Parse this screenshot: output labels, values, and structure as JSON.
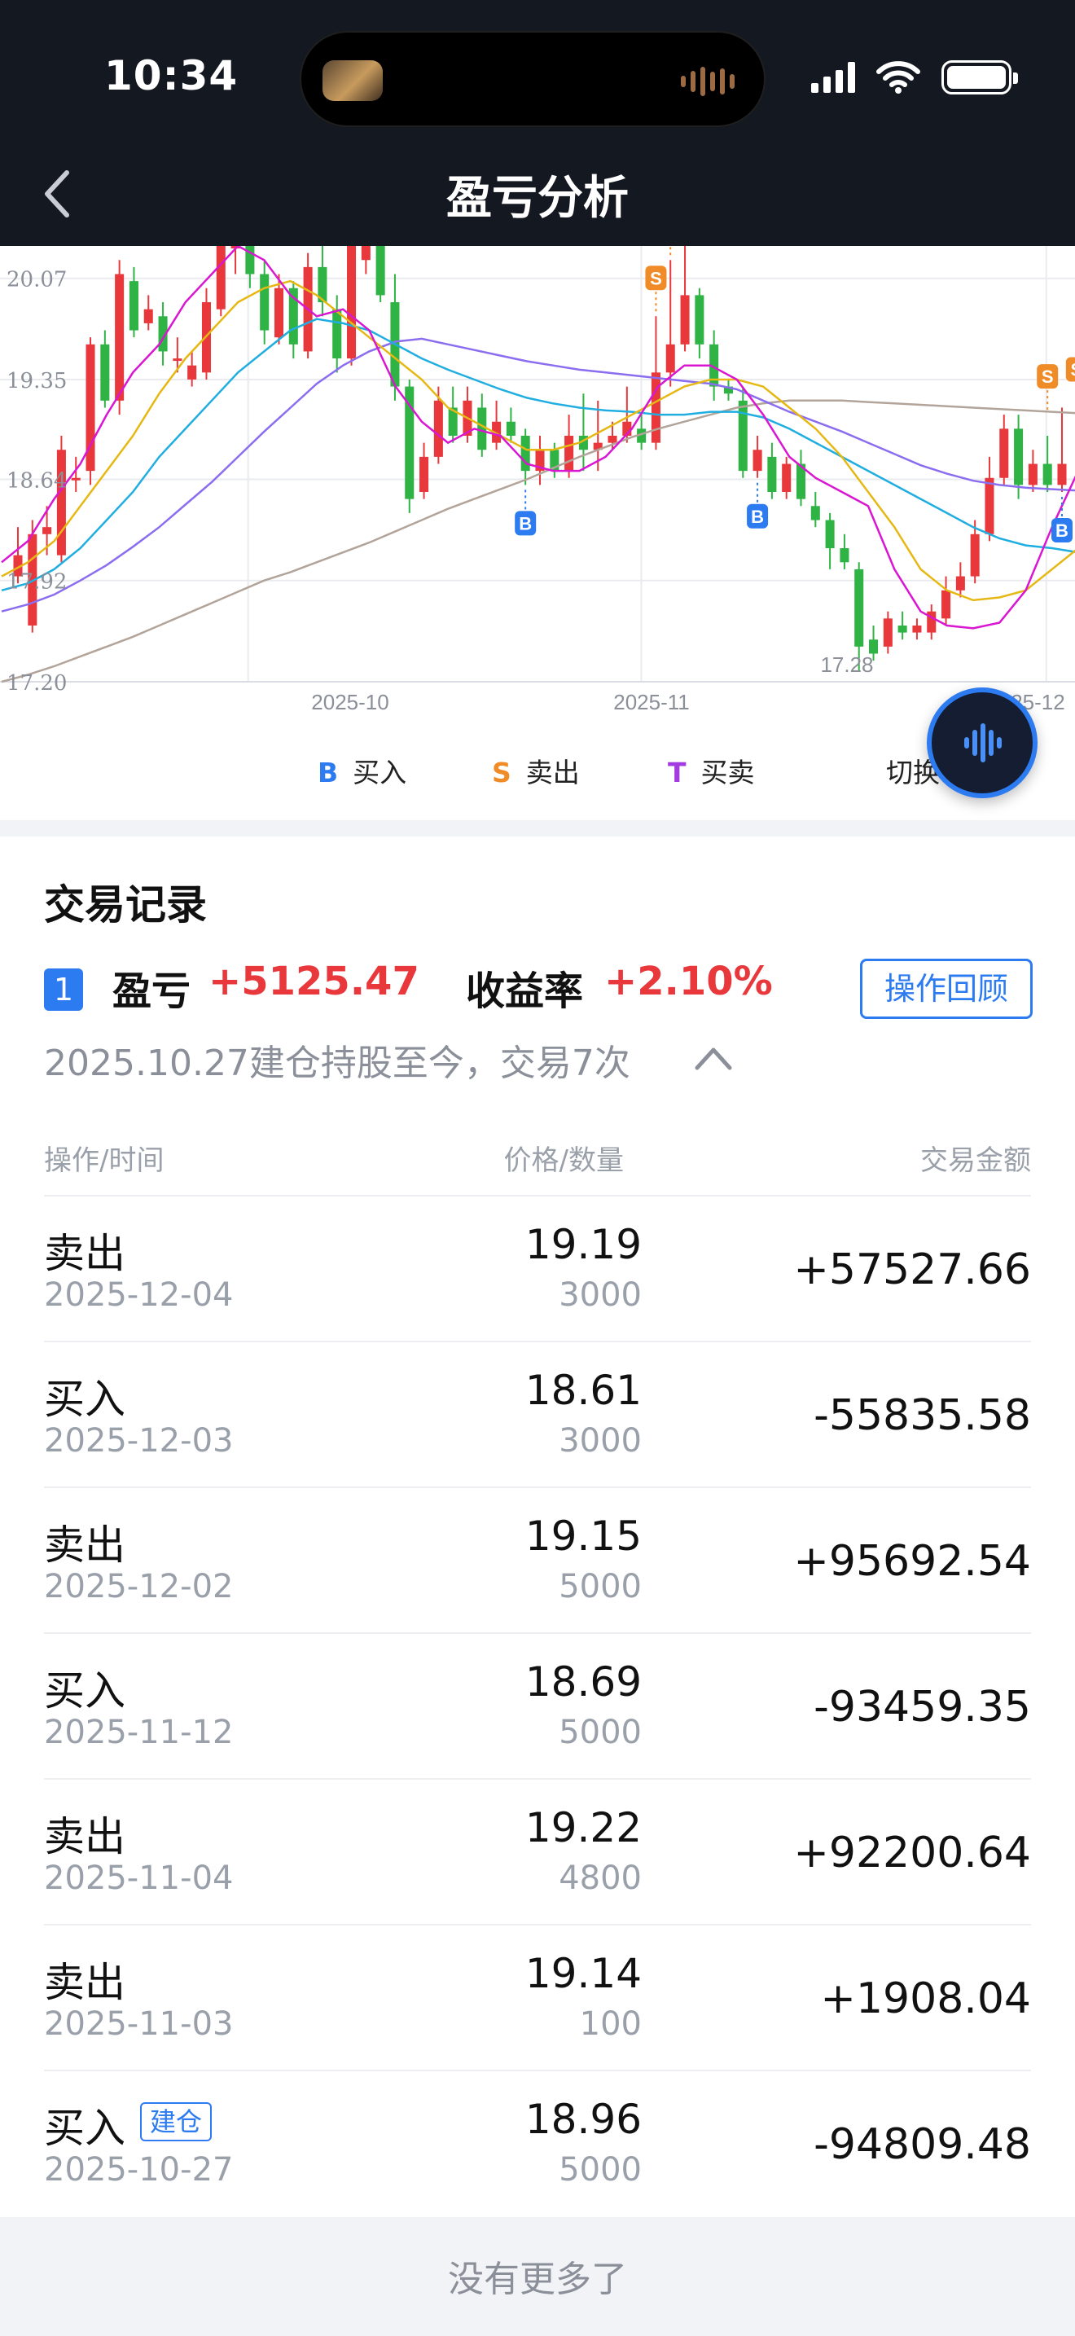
{
  "status_bar": {
    "time": "10:34"
  },
  "nav": {
    "title": "盈亏分析"
  },
  "chart": {
    "y_labels": [
      "20.07",
      "19.35",
      "18.64",
      "17.92",
      "17.20"
    ],
    "x_labels": [
      "2025-10",
      "2025-11",
      "2025-12"
    ],
    "min_label": "17.28",
    "legend": [
      {
        "key": "B",
        "label": "买入",
        "color": "#2d7bf0"
      },
      {
        "key": "S",
        "label": "卖出",
        "color": "#f08c28"
      },
      {
        "key": "T",
        "label": "买卖",
        "color": "#a23be0"
      }
    ],
    "switch_label": "切换",
    "colors": {
      "up": "#e8383c",
      "down": "#2fb344",
      "ma5": "#d916d1",
      "ma10": "#e6b814",
      "ma20": "#20aee0",
      "ma30": "#8b6df0",
      "ma60": "#b3a49a"
    }
  },
  "chart_data": {
    "type": "candlestick",
    "ylim": [
      17.2,
      20.3
    ],
    "x_ticks": [
      "2025-10",
      "2025-11",
      "2025-12"
    ],
    "y_ticks": [
      20.07,
      19.35,
      18.64,
      17.92,
      17.2
    ],
    "candles": [
      [
        17.95,
        18.1,
        17.9,
        18.3
      ],
      [
        17.6,
        18.25,
        17.55,
        18.35
      ],
      [
        18.25,
        18.3,
        18.1,
        18.45
      ],
      [
        18.1,
        18.85,
        18.05,
        18.95
      ],
      [
        18.65,
        18.65,
        18.55,
        18.8
      ],
      [
        18.7,
        19.6,
        18.6,
        19.65
      ],
      [
        19.6,
        19.2,
        19.15,
        19.7
      ],
      [
        19.2,
        20.1,
        19.1,
        20.2
      ],
      [
        20.05,
        19.7,
        19.65,
        20.15
      ],
      [
        19.75,
        19.85,
        19.7,
        19.95
      ],
      [
        19.8,
        19.55,
        19.45,
        19.9
      ],
      [
        19.5,
        19.5,
        19.4,
        19.65
      ],
      [
        19.35,
        19.45,
        19.3,
        19.55
      ],
      [
        19.4,
        19.9,
        19.35,
        20.0
      ],
      [
        19.85,
        20.3,
        19.8,
        20.5
      ],
      [
        20.3,
        20.3,
        20.1,
        20.5
      ],
      [
        20.3,
        20.1,
        20.0,
        20.4
      ],
      [
        20.1,
        19.7,
        19.6,
        20.2
      ],
      [
        19.65,
        20.0,
        19.6,
        20.1
      ],
      [
        20.0,
        19.6,
        19.5,
        20.05
      ],
      [
        19.55,
        20.15,
        19.5,
        20.25
      ],
      [
        20.15,
        19.9,
        19.8,
        20.3
      ],
      [
        19.85,
        19.5,
        19.4,
        19.95
      ],
      [
        19.5,
        20.3,
        19.45,
        20.45
      ],
      [
        20.2,
        20.4,
        20.1,
        20.5
      ],
      [
        20.4,
        19.95,
        19.9,
        20.45
      ],
      [
        19.9,
        19.3,
        19.2,
        20.1
      ],
      [
        19.3,
        18.5,
        18.4,
        19.35
      ],
      [
        18.55,
        18.8,
        18.5,
        18.9
      ],
      [
        18.8,
        19.2,
        18.75,
        19.3
      ],
      [
        19.15,
        18.95,
        18.9,
        19.3
      ],
      [
        18.95,
        19.2,
        18.9,
        19.3
      ],
      [
        19.15,
        18.85,
        18.8,
        19.25
      ],
      [
        18.9,
        19.05,
        18.85,
        19.2
      ],
      [
        19.05,
        18.95,
        18.9,
        19.15
      ],
      [
        18.95,
        18.7,
        18.6,
        19.0
      ],
      [
        18.7,
        18.85,
        18.6,
        18.95
      ],
      [
        18.85,
        18.7,
        18.65,
        18.9
      ],
      [
        18.7,
        18.95,
        18.65,
        19.1
      ],
      [
        18.95,
        18.85,
        18.7,
        19.25
      ],
      [
        18.85,
        18.9,
        18.7,
        19.2
      ],
      [
        18.9,
        18.95,
        18.85,
        19.05
      ],
      [
        18.95,
        19.05,
        18.9,
        19.3
      ],
      [
        19.0,
        18.9,
        18.85,
        19.1
      ],
      [
        18.9,
        19.4,
        18.85,
        19.8
      ],
      [
        19.4,
        19.6,
        19.3,
        20.2
      ],
      [
        19.6,
        19.95,
        19.55,
        20.3
      ],
      [
        19.95,
        19.6,
        19.5,
        20.0
      ],
      [
        19.6,
        19.3,
        19.2,
        19.7
      ],
      [
        19.3,
        19.25,
        19.2,
        19.35
      ],
      [
        19.2,
        18.7,
        18.65,
        19.3
      ],
      [
        18.7,
        18.85,
        18.65,
        18.95
      ],
      [
        18.8,
        18.55,
        18.5,
        18.9
      ],
      [
        18.55,
        18.75,
        18.5,
        18.8
      ],
      [
        18.75,
        18.5,
        18.45,
        18.85
      ],
      [
        18.45,
        18.35,
        18.3,
        18.55
      ],
      [
        18.35,
        18.15,
        18.0,
        18.4
      ],
      [
        18.15,
        18.05,
        18.0,
        18.25
      ],
      [
        18.0,
        17.45,
        17.28,
        18.05
      ],
      [
        17.5,
        17.4,
        17.35,
        17.6
      ],
      [
        17.45,
        17.65,
        17.4,
        17.7
      ],
      [
        17.6,
        17.55,
        17.5,
        17.7
      ],
      [
        17.55,
        17.6,
        17.5,
        17.65
      ],
      [
        17.55,
        17.7,
        17.5,
        17.75
      ],
      [
        17.65,
        17.85,
        17.6,
        17.95
      ],
      [
        17.85,
        17.95,
        17.8,
        18.05
      ],
      [
        17.95,
        18.25,
        17.9,
        18.35
      ],
      [
        18.25,
        18.65,
        18.2,
        18.8
      ],
      [
        18.65,
        19.0,
        18.6,
        19.1
      ],
      [
        19.0,
        18.6,
        18.5,
        19.1
      ],
      [
        18.6,
        18.75,
        18.55,
        18.85
      ],
      [
        18.75,
        18.6,
        18.55,
        18.95
      ],
      [
        18.6,
        18.75,
        18.55,
        19.15
      ]
    ],
    "ma5": [
      18.05,
      18.2,
      18.5,
      18.75,
      19.1,
      19.4,
      19.6,
      19.9,
      20.1,
      20.3,
      20.2,
      19.95,
      19.8,
      19.85,
      19.7,
      19.3,
      19.05,
      18.9,
      19.0,
      18.95,
      18.75,
      18.7,
      18.7,
      18.8,
      19.0,
      19.3,
      19.45,
      19.45,
      19.35,
      19.1,
      18.8,
      18.65,
      18.55,
      18.45,
      18.0,
      17.7,
      17.6,
      17.58,
      17.62,
      17.85,
      18.3,
      18.7
    ],
    "ma10": [
      17.95,
      18.05,
      18.2,
      18.45,
      18.7,
      18.95,
      19.25,
      19.5,
      19.7,
      19.9,
      20.0,
      20.05,
      19.95,
      19.8,
      19.65,
      19.5,
      19.35,
      19.15,
      19.05,
      18.95,
      18.85,
      18.85,
      18.9,
      19.0,
      19.1,
      19.2,
      19.3,
      19.35,
      19.35,
      19.3,
      19.15,
      19.0,
      18.8,
      18.55,
      18.3,
      18.0,
      17.85,
      17.78,
      17.8,
      17.85,
      18.0,
      18.15
    ],
    "ma20": [
      17.85,
      17.9,
      18.0,
      18.15,
      18.35,
      18.55,
      18.8,
      19.0,
      19.2,
      19.4,
      19.55,
      19.7,
      19.78,
      19.75,
      19.7,
      19.6,
      19.5,
      19.42,
      19.35,
      19.28,
      19.22,
      19.18,
      19.15,
      19.13,
      19.12,
      19.1,
      19.1,
      19.12,
      19.12,
      19.08,
      19.0,
      18.9,
      18.8,
      18.7,
      18.6,
      18.5,
      18.4,
      18.3,
      18.22,
      18.17,
      18.15,
      18.12
    ],
    "ma30": [
      17.7,
      17.75,
      17.82,
      17.92,
      18.03,
      18.16,
      18.3,
      18.46,
      18.62,
      18.8,
      18.98,
      19.15,
      19.32,
      19.45,
      19.55,
      19.62,
      19.64,
      19.6,
      19.56,
      19.52,
      19.48,
      19.45,
      19.42,
      19.4,
      19.38,
      19.36,
      19.34,
      19.32,
      19.28,
      19.2,
      19.12,
      19.05,
      18.98,
      18.9,
      18.82,
      18.74,
      18.68,
      18.63,
      18.6,
      18.58,
      18.57,
      18.56
    ],
    "ma60": [
      17.2,
      17.25,
      17.31,
      17.38,
      17.45,
      17.52,
      17.6,
      17.68,
      17.76,
      17.84,
      17.92,
      17.98,
      18.05,
      18.12,
      18.19,
      18.27,
      18.35,
      18.43,
      18.5,
      18.57,
      18.64,
      18.72,
      18.8,
      18.87,
      18.94,
      19.0,
      19.05,
      19.1,
      19.15,
      19.18,
      19.2,
      19.2,
      19.2,
      19.19,
      19.18,
      19.17,
      19.16,
      19.15,
      19.14,
      19.13,
      19.12,
      19.11
    ],
    "markers": [
      {
        "type": "B",
        "candle_index": 35,
        "value": 18.6
      },
      {
        "type": "S",
        "candle_index": 44,
        "value": 19.8
      },
      {
        "type": "S",
        "candle_index": 45,
        "value": 20.2
      },
      {
        "type": "B",
        "candle_index": 51,
        "value": 18.65
      },
      {
        "type": "S",
        "candle_index": 71,
        "value": 19.1
      },
      {
        "type": "B",
        "candle_index": 72,
        "value": 18.55
      },
      {
        "type": "S",
        "candle_index": 73,
        "value": 19.15
      }
    ]
  },
  "records": {
    "title": "交易记录",
    "rank": "1",
    "pl_label": "盈亏",
    "pl_value": "+5125.47",
    "rr_label": "收益率",
    "rr_value": "+2.10%",
    "review_button": "操作回顾",
    "sub_info": "2025.10.27建仓持股至今，交易7次",
    "columns": {
      "op_time": "操作/时间",
      "price_qty": "价格/数量",
      "amount": "交易金额"
    },
    "rows": [
      {
        "op": "卖出",
        "date": "2025-12-04",
        "price": "19.19",
        "qty": "3000",
        "amount": "+57527.66",
        "tag": ""
      },
      {
        "op": "买入",
        "date": "2025-12-03",
        "price": "18.61",
        "qty": "3000",
        "amount": "-55835.58",
        "tag": ""
      },
      {
        "op": "卖出",
        "date": "2025-12-02",
        "price": "19.15",
        "qty": "5000",
        "amount": "+95692.54",
        "tag": ""
      },
      {
        "op": "买入",
        "date": "2025-11-12",
        "price": "18.69",
        "qty": "5000",
        "amount": "-93459.35",
        "tag": ""
      },
      {
        "op": "卖出",
        "date": "2025-11-04",
        "price": "19.22",
        "qty": "4800",
        "amount": "+92200.64",
        "tag": ""
      },
      {
        "op": "卖出",
        "date": "2025-11-03",
        "price": "19.14",
        "qty": "100",
        "amount": "+1908.04",
        "tag": ""
      },
      {
        "op": "买入",
        "date": "2025-10-27",
        "price": "18.96",
        "qty": "5000",
        "amount": "-94809.48",
        "tag": "建仓"
      }
    ]
  },
  "footer": {
    "text": "没有更多了"
  }
}
